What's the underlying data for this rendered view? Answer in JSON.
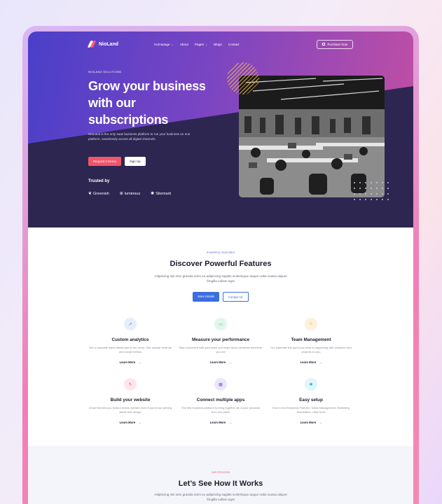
{
  "nav": {
    "logo": "NioLand",
    "items": [
      {
        "label": "Homepage",
        "dropdown": true
      },
      {
        "label": "About",
        "dropdown": false
      },
      {
        "label": "Pages",
        "dropdown": true
      },
      {
        "label": "Blogs",
        "dropdown": false
      },
      {
        "label": "Contact",
        "dropdown": false
      }
    ],
    "purchase": "Purchase Now"
  },
  "hero": {
    "eyebrow": "NIOLAND SOLUTIONS",
    "headline": "Grow your business with our subscriptions",
    "description": "NioLand is the only saas business platform to run your business on one platform, seamlessly across all digital channels.",
    "primary_cta": "Request A Demo",
    "secondary_cta": "Sign Up",
    "trusted_label": "Trusted by",
    "brands": [
      {
        "name": "Greenish",
        "icon": "leaf-icon",
        "glyph": "❦"
      },
      {
        "name": "luminous",
        "icon": "plus-circle-icon",
        "glyph": "⊕"
      },
      {
        "name": "Sitemark",
        "icon": "sparkle-icon",
        "glyph": "✺"
      }
    ]
  },
  "features": {
    "eyebrow": "POWERFUL FEATURES",
    "title": "Discover Powerful Features",
    "subtitle": "Adipiscing nisi sem gravida enim eu adipiscing sagittis scelerisque augue nulla massa aliquet fringilla nullam eget",
    "primary_cta": "More Details",
    "secondary_cta": "Contact Us",
    "learn_more": "Learn More",
    "cards": [
      {
        "title": "Custom analytics",
        "desc": "Get a complete sales dashboard in the cloud. See activity, revenue and social metrics",
        "icon": "chart-icon",
        "glyph": "↗",
        "bg": "#e6eefc",
        "fg": "#3c6ee0"
      },
      {
        "title": "Measure your performance",
        "desc": "Stay connected with your team and make quick decisions wherever you are",
        "icon": "display-icon",
        "glyph": "▭",
        "bg": "#e2f6ea",
        "fg": "#2fb56b"
      },
      {
        "title": "Team Management",
        "desc": "Our calendar lets you know what is happening with customer and projects so you",
        "icon": "team-icon",
        "glyph": "☺",
        "bg": "#fdf0dd",
        "fg": "#f0a33c"
      },
      {
        "title": "Build your website",
        "desc": "A tool that lets you build a dream website even if you know nothing about web design",
        "icon": "brush-icon",
        "glyph": "✎",
        "bg": "#fde6ea",
        "fg": "#f0566a"
      },
      {
        "title": "Connect multiple apps",
        "desc": "The first business platform to bring together all of your products from one place",
        "icon": "apps-icon",
        "glyph": "▦",
        "bg": "#ece6fb",
        "fg": "#7a55d9"
      },
      {
        "title": "Easy setup",
        "desc": "End to End Business Platform, Sales Management, Marketing Automation, Help Desk",
        "icon": "settings-icon",
        "glyph": "✱",
        "bg": "#e0f6f8",
        "fg": "#2ab3c4"
      }
    ]
  },
  "how": {
    "eyebrow": "OUR PROCESS",
    "title": "Let’s See How It Works",
    "subtitle": "Adipiscing nisi sem gravida enim eu adipiscing sagittis scelerisque augue nulla massa aliquet fringilla nullam eget"
  },
  "colors": {
    "hero_gradient_start": "#4a3fc9",
    "hero_gradient_end": "#c54fa2",
    "hero_dark": "#2d2651",
    "accent_red": "#f0566a",
    "accent_blue": "#3c6ee0"
  }
}
